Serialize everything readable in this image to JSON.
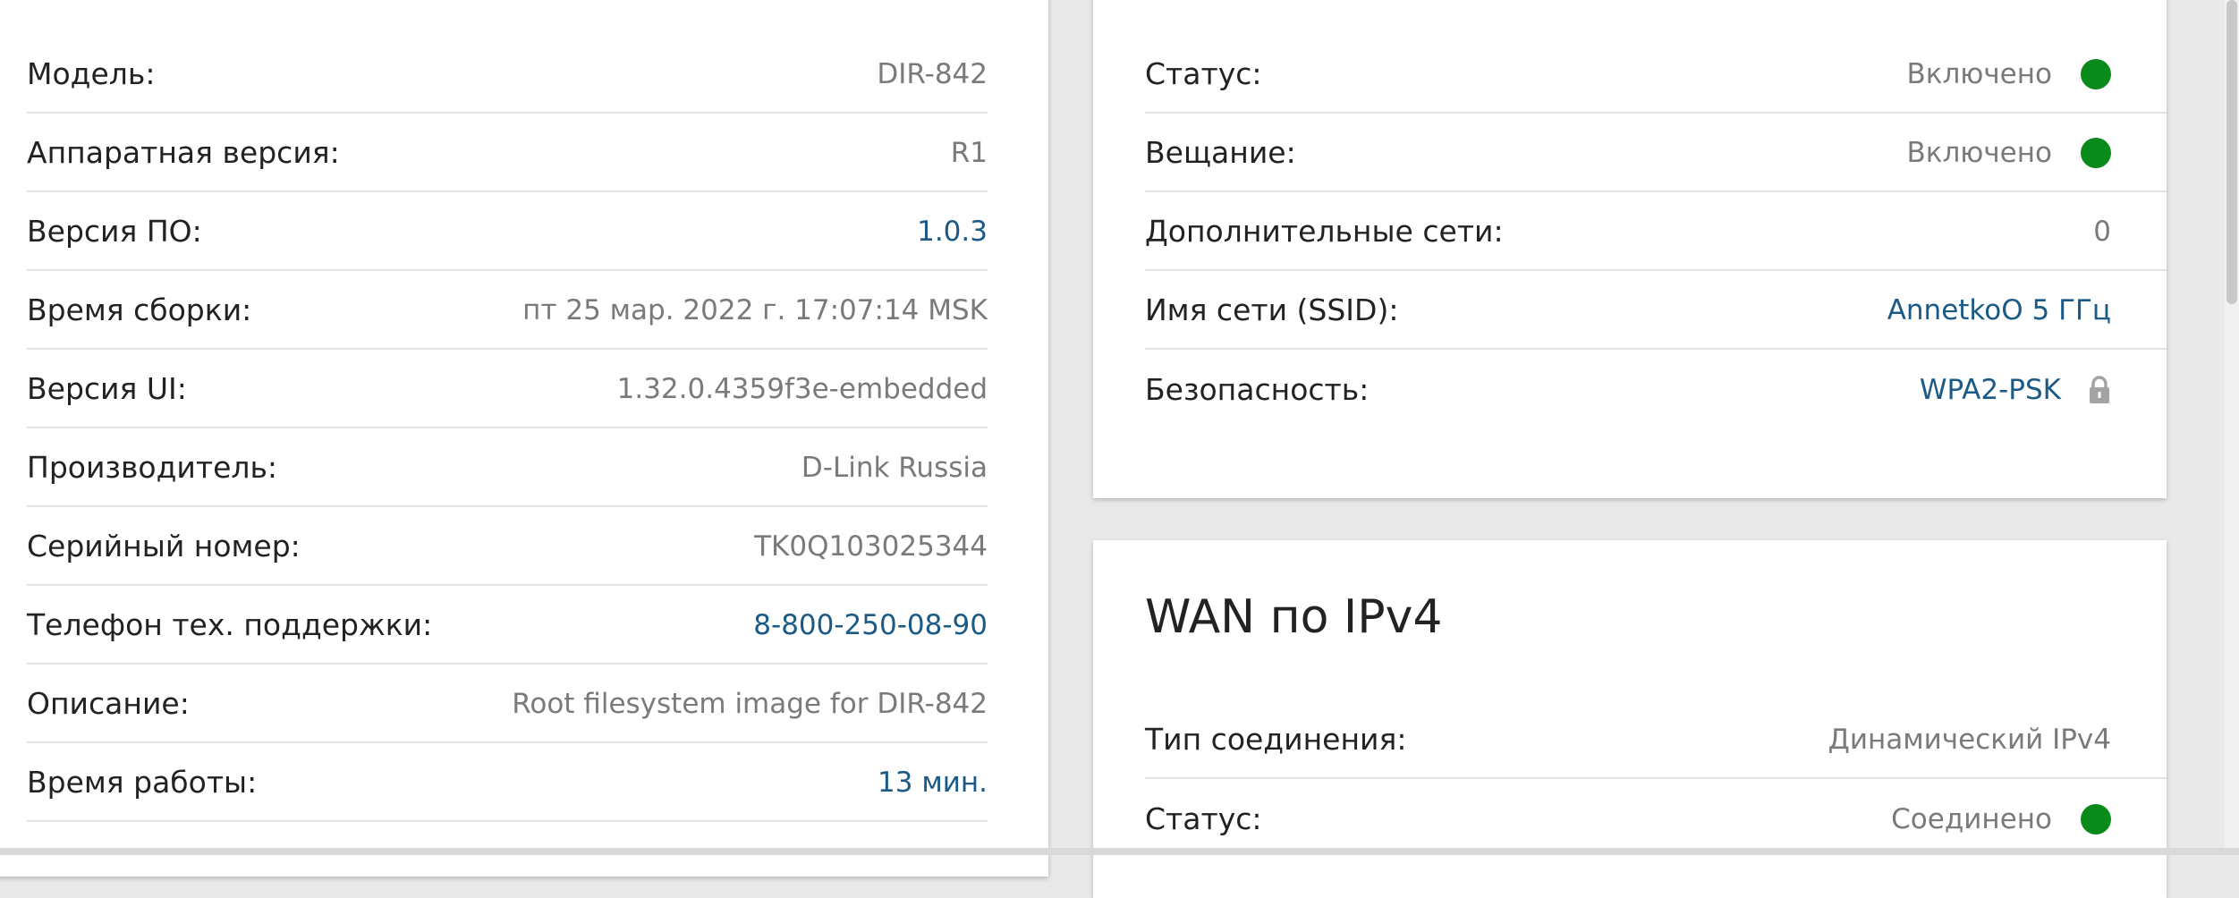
{
  "device_info": {
    "rows": [
      {
        "label": "Модель:",
        "value": "DIR-842",
        "link": false
      },
      {
        "label": "Аппаратная версия:",
        "value": "R1",
        "link": false
      },
      {
        "label": "Версия ПО:",
        "value": "1.0.3",
        "link": true
      },
      {
        "label": "Время сборки:",
        "value": "пт 25 мар. 2022 г. 17:07:14 MSK",
        "link": false
      },
      {
        "label": "Версия UI:",
        "value": "1.32.0.4359f3e-embedded",
        "link": false
      },
      {
        "label": "Производитель:",
        "value": "D-Link Russia",
        "link": false
      },
      {
        "label": "Серийный номер:",
        "value": "TK0Q103025344",
        "link": false
      },
      {
        "label": "Телефон тех. поддержки:",
        "value": "8-800-250-08-90",
        "link": true
      },
      {
        "label": "Описание:",
        "value": "Root filesystem image for DIR-842",
        "link": false
      },
      {
        "label": "Время работы:",
        "value": "13 мин.",
        "link": true
      }
    ]
  },
  "wifi": {
    "rows": [
      {
        "label": "Статус:",
        "value": "Включено",
        "indicator": "green"
      },
      {
        "label": "Вещание:",
        "value": "Включено",
        "indicator": "green"
      },
      {
        "label": "Дополнительные сети:",
        "value": "0"
      },
      {
        "label": "Имя сети (SSID):",
        "value": "AnnetkoO 5 ГГц",
        "link": true
      },
      {
        "label": "Безопасность:",
        "value": "WPA2-PSK",
        "link": true,
        "icon": "lock-icon"
      }
    ]
  },
  "wan": {
    "title": "WAN по IPv4",
    "rows": [
      {
        "label": "Тип соединения:",
        "value": "Динамический IPv4"
      },
      {
        "label": "Статус:",
        "value": "Соединено",
        "indicator": "green"
      }
    ]
  },
  "colors": {
    "link": "#1b5a86",
    "indicator_green": "#0b8a1c",
    "value_gray": "#7a7a7a"
  }
}
